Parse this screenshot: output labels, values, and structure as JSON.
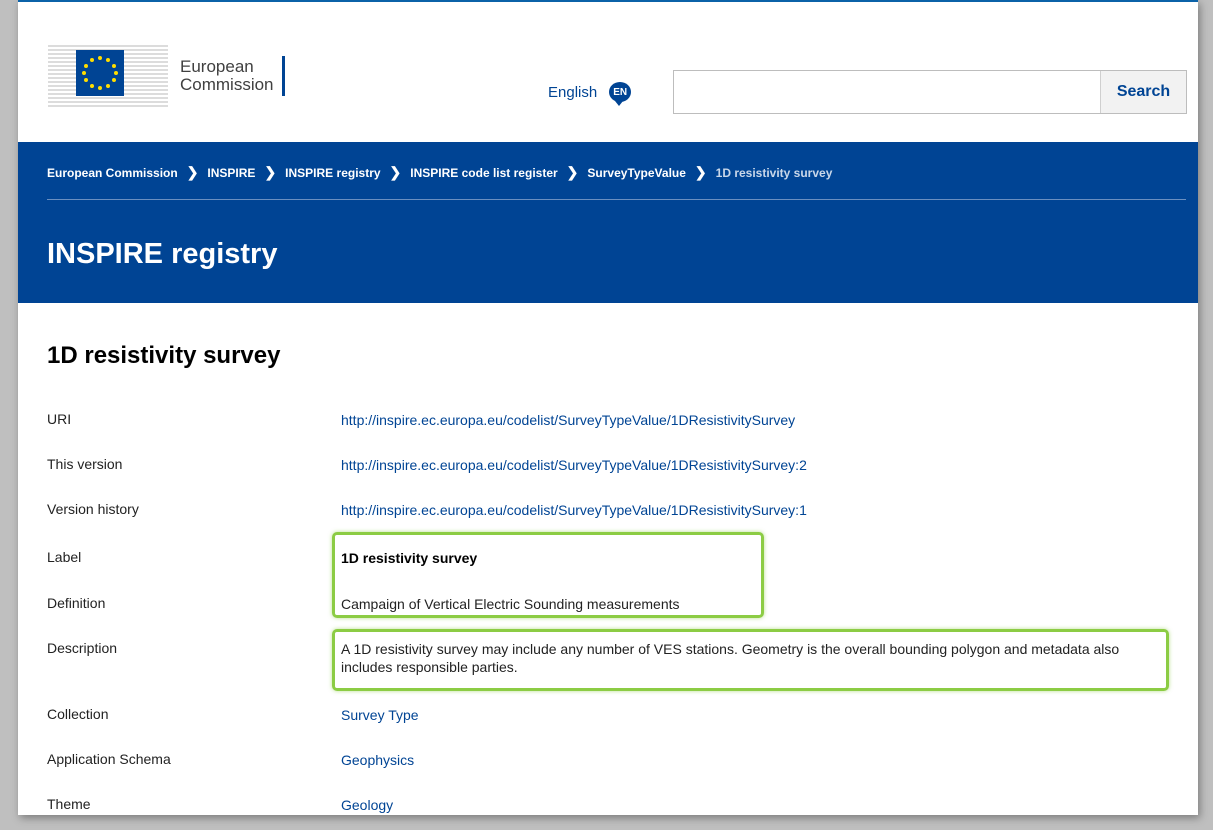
{
  "header": {
    "logo_line1": "European",
    "logo_line2": "Commission",
    "language_label": "English",
    "language_code": "EN",
    "search_placeholder": "",
    "search_button": "Search"
  },
  "breadcrumb": [
    "European Commission",
    "INSPIRE",
    "INSPIRE registry",
    "INSPIRE code list register",
    "SurveyTypeValue",
    "1D resistivity survey"
  ],
  "band_title": "INSPIRE registry",
  "page_title": "1D resistivity survey",
  "fields": {
    "uri": {
      "label": "URI",
      "value": "http://inspire.ec.europa.eu/codelist/SurveyTypeValue/1DResistivitySurvey"
    },
    "this_version": {
      "label": "This version",
      "value": "http://inspire.ec.europa.eu/codelist/SurveyTypeValue/1DResistivitySurvey:2"
    },
    "version_history": {
      "label": "Version history",
      "value": "http://inspire.ec.europa.eu/codelist/SurveyTypeValue/1DResistivitySurvey:1"
    },
    "label": {
      "label": "Label",
      "value": "1D resistivity survey"
    },
    "definition": {
      "label": "Definition",
      "value": "Campaign of Vertical Electric Sounding measurements"
    },
    "description": {
      "label": "Description",
      "value": "A 1D resistivity survey may include any number of VES stations. Geometry is the overall bounding polygon and metadata also includes responsible parties."
    },
    "collection": {
      "label": "Collection",
      "value": "Survey Type"
    },
    "application_schema": {
      "label": "Application Schema",
      "value": "Geophysics"
    },
    "theme": {
      "label": "Theme",
      "value": "Geology"
    }
  },
  "colors": {
    "brand_blue": "#004494",
    "highlight_green": "#8ccc44",
    "eu_yellow": "#ffdd00"
  }
}
